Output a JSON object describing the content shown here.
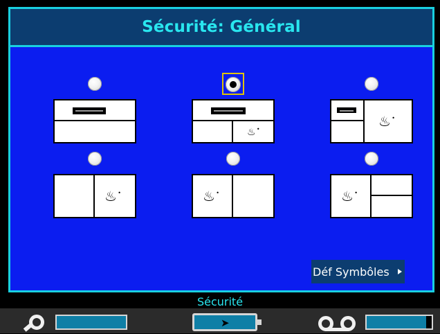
{
  "window": {
    "title": "Sécurité: Général"
  },
  "options": [
    {
      "id": "layout-1",
      "selected": false,
      "icon": "flame-symbol"
    },
    {
      "id": "layout-2",
      "selected": true,
      "icon": "flame-symbol"
    },
    {
      "id": "layout-3",
      "selected": false,
      "icon": "flame-symbol"
    },
    {
      "id": "layout-4",
      "selected": false,
      "icon": "flame-symbol"
    },
    {
      "id": "layout-5",
      "selected": false,
      "icon": "flame-symbol"
    },
    {
      "id": "layout-6",
      "selected": false,
      "icon": "flame-symbol"
    }
  ],
  "buttons": {
    "define_symbols": "Déf Symbôles"
  },
  "status": {
    "mode_label": "Sécurité"
  },
  "colors": {
    "background": "#0b1df0",
    "titlebar": "#0c3d70",
    "accent": "#29e6ef",
    "focus": "#e0c400"
  }
}
